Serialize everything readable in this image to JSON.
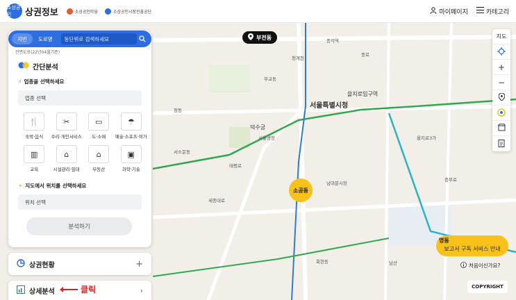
{
  "header": {
    "badge_text": "소상공인",
    "brand_title": "상권정보",
    "partners": [
      {
        "name": "소상공인마당",
        "color": "#e95b2c"
      },
      {
        "name": "소상공인시장진흥공단",
        "color": "#2f6ee0"
      }
    ],
    "mypage_label": "마이페이지",
    "category_label": "카테고리"
  },
  "search": {
    "tabs": [
      "지번",
      "도로명"
    ],
    "active_tab": "지번",
    "placeholder": "동단위로 검색하세요"
  },
  "date_note": "전면도로(22년04월기준)",
  "simple_analysis": {
    "title": "간단분석",
    "industry_label": "업종을 선택하세요",
    "industry_select": "업종 선택",
    "categories": [
      {
        "icon": "fork-knife-icon",
        "glyph": "🍴",
        "label": "숙박·음식"
      },
      {
        "icon": "tools-icon",
        "glyph": "✂",
        "label": "수리·개인서비스"
      },
      {
        "icon": "shop-icon",
        "glyph": "▭",
        "label": "도·소매"
      },
      {
        "icon": "art-sports-icon",
        "glyph": "☂",
        "label": "예술·스포츠·여가"
      },
      {
        "icon": "book-icon",
        "glyph": "▥",
        "label": "교육"
      },
      {
        "icon": "facility-icon",
        "glyph": "⌂",
        "label": "시설관리·임대"
      },
      {
        "icon": "realestate-icon",
        "glyph": "⌂",
        "label": "부동산"
      },
      {
        "icon": "science-icon",
        "glyph": "▣",
        "label": "과학·기술"
      }
    ],
    "location_label": "지도에서 위치를 선택하세요",
    "location_select": "위치 선택",
    "analyze_button": "분석하기"
  },
  "status_panel": {
    "title": "상권현황"
  },
  "detail_panel": {
    "title": "상세분석"
  },
  "annotation": {
    "text": "클릭",
    "color": "#e41c1c"
  },
  "map": {
    "location_pill": "부전동",
    "labels": [
      "서울특별시청",
      "을지로입구역",
      "덕수궁",
      "서울광장",
      "명동",
      "소공동",
      "회현동",
      "남대문시장",
      "종각역",
      "무교동",
      "을지로3가",
      "충무로",
      "정동",
      "서소문동",
      "세종대로",
      "남산",
      "태평로",
      "종로",
      "청계천"
    ],
    "dong_markers": [
      "소공동",
      "명동"
    ]
  },
  "toolbar": {
    "items": [
      "지도",
      "위치",
      "+",
      "−",
      "위치",
      "로드뷰",
      "저장",
      "인쇄"
    ]
  },
  "promo": {
    "dong": "명동",
    "text": "보고서 구독 서비스 안내"
  },
  "first_time": "처음이신가요?",
  "copyright": "COPYRIGHT",
  "colors": {
    "brand": "#2f6ee0",
    "accent_yellow": "#f8c21a",
    "annotation_red": "#e41c1c"
  }
}
